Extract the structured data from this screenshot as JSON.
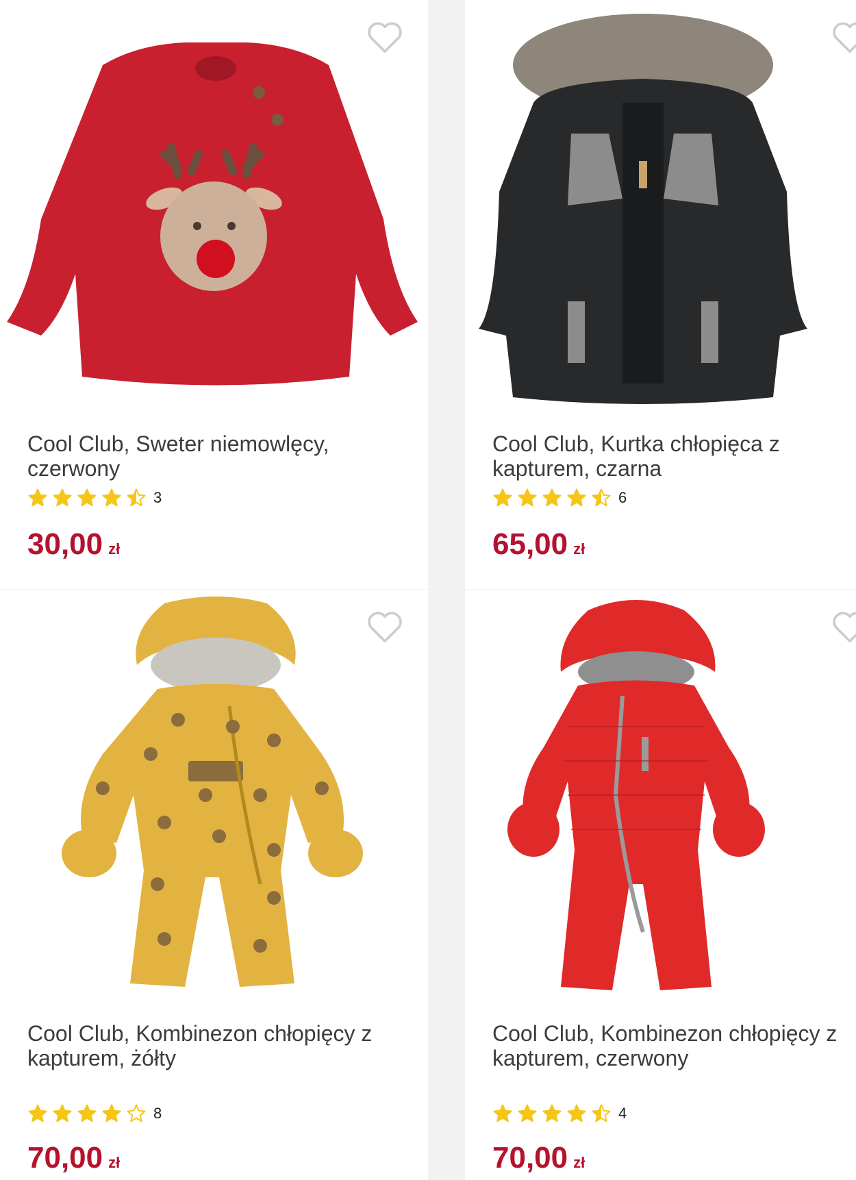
{
  "products": [
    {
      "title": "Cool Club, Sweter niemowlęcy, czerwony",
      "rating": 4.5,
      "rating_count": "3",
      "price": "30,00",
      "currency": "zł",
      "image_icon": "red-reindeer-sweater-image"
    },
    {
      "title": "Cool Club, Kurtka chłopięca z kapturem, czarna",
      "rating": 4.5,
      "rating_count": "6",
      "price": "65,00",
      "currency": "zł",
      "image_icon": "black-hooded-jacket-image"
    },
    {
      "title": "Cool Club, Kombinezon chłopięcy z kapturem, żółty",
      "rating": 4,
      "rating_count": "8",
      "price": "70,00",
      "currency": "zł",
      "image_icon": "yellow-bear-snowsuit-image"
    },
    {
      "title": "Cool Club, Kombinezon chłopięcy z kapturem, czerwony",
      "rating": 4.5,
      "rating_count": "4",
      "price": "70,00",
      "currency": "zł",
      "image_icon": "red-snowsuit-image"
    }
  ],
  "colors": {
    "price": "#b5122e",
    "star": "#f5c518",
    "heart_outline": "#cccccc"
  }
}
